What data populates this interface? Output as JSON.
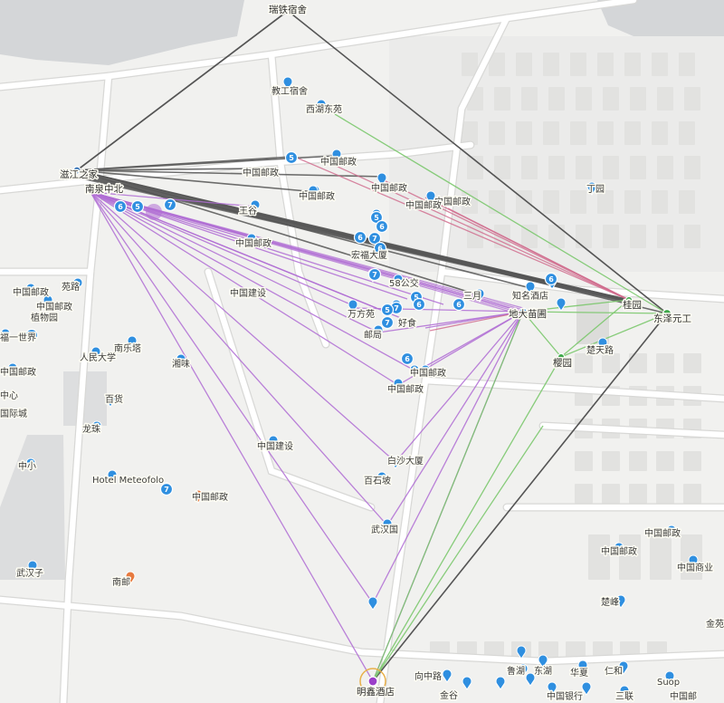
{
  "map": {
    "title": "",
    "nodes": [
      {
        "id": "n_top",
        "label": "瑞铁宿舍"
      },
      {
        "id": "n_west",
        "label": "滋江之家"
      },
      {
        "id": "n_west2",
        "label": "南泉中北"
      },
      {
        "id": "n_east",
        "label": "东泽元工"
      },
      {
        "id": "n_center",
        "label": "地大苗圃"
      },
      {
        "id": "n_south",
        "label": "明鑫酒店"
      },
      {
        "id": "n_green1",
        "label": "桂园"
      },
      {
        "id": "n_green2",
        "label": "樱园"
      }
    ],
    "place_labels": [
      "教工宿舍",
      "西湖东苑",
      "中国邮政",
      "中国邮政",
      "中国邮政",
      "中国邮政",
      "中国邮政",
      "中国邮政",
      "王谷",
      "中国邮政",
      "中国建设",
      "宏福大厦",
      "58公交",
      "万方苑",
      "好食",
      "三月",
      "知名酒店",
      "中国邮政",
      "中国邮政",
      "邮局",
      "丁园",
      "南乐塔",
      "人民大学",
      "湘味",
      "百货",
      "龙珠",
      "中小",
      "武汉子",
      "Hotel Meteofolo",
      "中国建设",
      "白沙大厦",
      "百石坡",
      "武汉国",
      "楚天路",
      "中国邮政",
      "中国邮政",
      "苑路",
      "植物园",
      "南邮",
      "中国邮政",
      "中国邮政",
      "中国邮政",
      "中国商业",
      "楚峰",
      "向中路",
      "金谷",
      "鲁湖",
      "东湖",
      "中国银行",
      "仁和",
      "Suop",
      "福一世界",
      "中国邮政",
      "中心",
      "国际城",
      "华夏",
      "三联",
      "中国邮",
      "金苑"
    ],
    "pin_numbers": [
      "5",
      "6",
      "5",
      "7",
      "5",
      "6",
      "7",
      "6",
      "6",
      "7",
      "5",
      "6",
      "6",
      "6",
      "7",
      "5",
      "7",
      "7",
      "6",
      "7"
    ],
    "colors": {
      "background": "#f1f1ef",
      "road": "#ffffff",
      "road_border": "#d8d8d6",
      "building": "#e2e2e0",
      "water": "#d4d6d8",
      "pin_blue": "#2f8fe0",
      "pin_orange": "#e77a3f",
      "edge_gray": "#555555",
      "edge_purple": "#b06dd4",
      "edge_green": "#7cc86e",
      "edge_pink": "#d06a8c",
      "node_green": "#3ea84a",
      "node_purple": "#9b3fc9"
    }
  }
}
